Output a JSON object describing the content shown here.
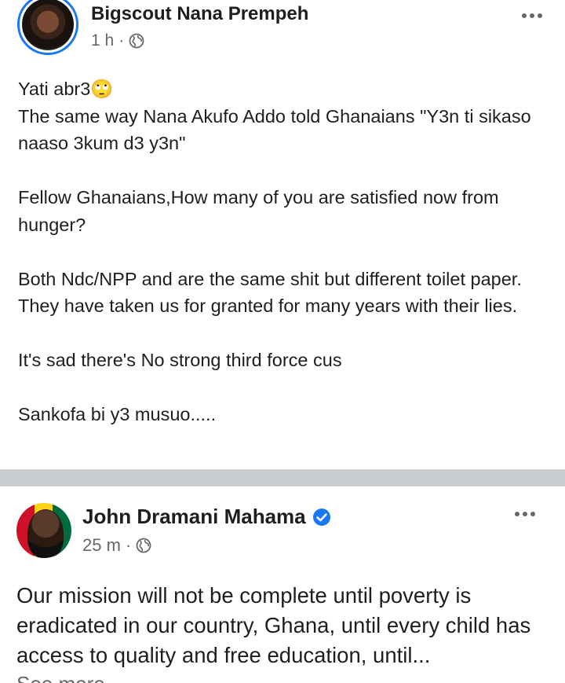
{
  "post1": {
    "author": "Bigscout Nana Prempeh",
    "time": "1 h",
    "separator": "·",
    "lines": [
      "Yati abr3🙄",
      "The same way Nana Akufo Addo told Ghanaians \"Y3n ti sikaso naaso 3kum d3 y3n\"",
      "",
      "Fellow Ghanaians,How many of you are satisfied now from hunger?",
      "",
      "Both Ndc/NPP and are the same shit but different toilet paper. They have taken us for granted for many years with their lies.",
      "",
      "It's sad there's No strong third force cus",
      "",
      "Sankofa bi y3 musuo....."
    ]
  },
  "post2": {
    "author": "John Dramani Mahama",
    "time": "25 m",
    "separator": "·",
    "text": "Our mission will not be complete until poverty is eradicated in our country, Ghana, until every child has access to quality and free education, until...",
    "see_more": "See more"
  },
  "colors": {
    "accent": "#1877f2",
    "secondary_text": "#65676b",
    "divider": "#c9ccd1"
  },
  "icons": {
    "globe": "globe-icon",
    "more": "more-options-icon",
    "verified": "verified-badge-icon"
  }
}
